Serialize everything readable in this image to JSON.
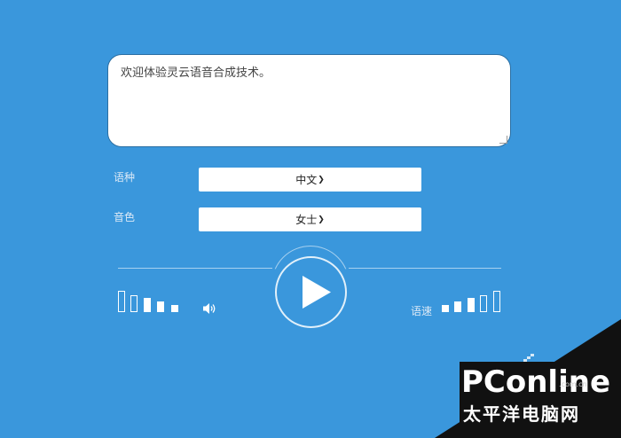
{
  "text_input": {
    "value": "欢迎体验灵云语音合成技术。"
  },
  "language": {
    "label": "语种",
    "selected": "中文"
  },
  "voice": {
    "label": "音色",
    "selected": "女士"
  },
  "speed": {
    "label": "语速"
  },
  "icons": {
    "dropdown": "chevron-down-icon",
    "volume": "speaker-icon",
    "play": "play-icon"
  },
  "watermark": {
    "brand": "PConline",
    "domain": ".com.cn",
    "cn": "太平洋电脑网"
  },
  "colors": {
    "background": "#3a97dc",
    "panel": "#ffffff"
  }
}
